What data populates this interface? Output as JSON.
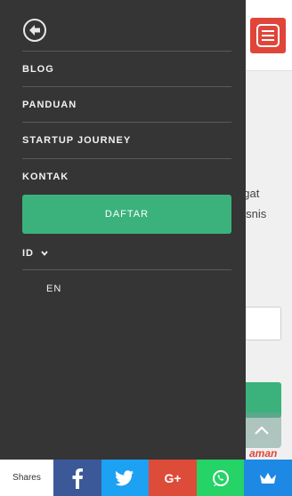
{
  "background": {
    "body_text_line1": "ngat",
    "body_text_line2": "bisnis",
    "safe_label": "aman"
  },
  "drawer": {
    "menu": [
      {
        "label": "BLOG"
      },
      {
        "label": "PANDUAN"
      },
      {
        "label": "STARTUP JOURNEY"
      },
      {
        "label": "KONTAK"
      }
    ],
    "cta_label": "DAFTAR",
    "language": {
      "current": "ID",
      "option": "EN"
    }
  },
  "share_bar": {
    "label": "Shares",
    "google_plus_label": "G+",
    "buttons": [
      {
        "icon": "facebook-icon",
        "color": "#3b5998"
      },
      {
        "icon": "twitter-icon",
        "color": "#1da1f2"
      },
      {
        "icon": "google-plus-icon",
        "color": "#dd4b39"
      },
      {
        "icon": "whatsapp-icon",
        "color": "#25d366"
      },
      {
        "icon": "crown-icon",
        "color": "#1e88e5"
      }
    ]
  },
  "colors": {
    "accent_red": "#e0453a",
    "accent_green": "#3bb27c",
    "drawer_bg": "#353535"
  }
}
